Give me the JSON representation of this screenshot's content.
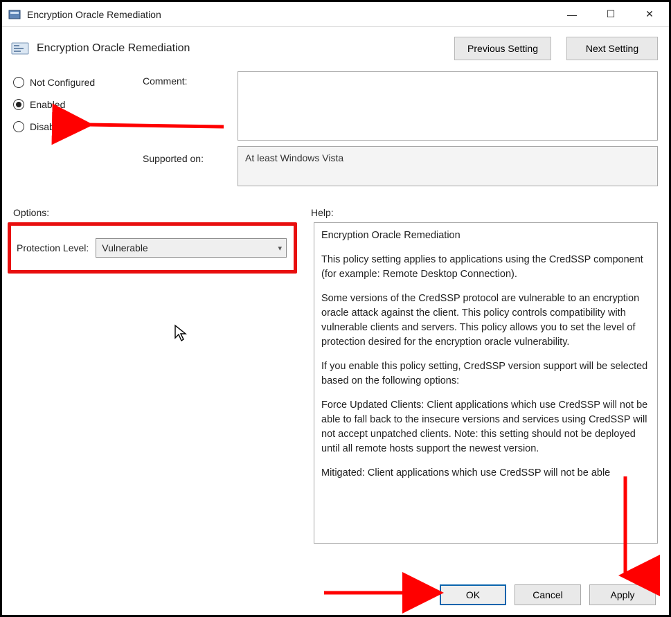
{
  "window": {
    "title": "Encryption Oracle Remediation",
    "minimize": "—",
    "maximize": "☐",
    "close": "✕"
  },
  "header": {
    "policy_title": "Encryption Oracle Remediation",
    "prev_btn": "Previous Setting",
    "next_btn": "Next Setting"
  },
  "radios": {
    "not_configured": "Not Configured",
    "enabled": "Enabled",
    "disabled": "Disabled",
    "selected": "enabled"
  },
  "labels": {
    "comment": "Comment:",
    "supported_on": "Supported on:",
    "options": "Options:",
    "help": "Help:",
    "protection_level": "Protection Level:"
  },
  "fields": {
    "comment_value": "",
    "supported_on_value": "At least Windows Vista",
    "protection_level_value": "Vulnerable"
  },
  "help": {
    "title": "Encryption Oracle Remediation",
    "p1": "This policy setting applies to applications using the CredSSP component (for example: Remote Desktop Connection).",
    "p2": "Some versions of the CredSSP protocol are vulnerable to an encryption oracle attack against the client.  This policy controls compatibility with vulnerable clients and servers.  This policy allows you to set the level of protection desired for the encryption oracle vulnerability.",
    "p3": "If you enable this policy setting, CredSSP version support will be selected based on the following options:",
    "p4": "Force Updated Clients: Client applications which use CredSSP will not be able to fall back to the insecure versions and services using CredSSP will not accept unpatched clients. Note: this setting should not be deployed until all remote hosts support the newest version.",
    "p5": "Mitigated: Client applications which use CredSSP will not be able"
  },
  "buttons": {
    "ok": "OK",
    "cancel": "Cancel",
    "apply": "Apply"
  }
}
